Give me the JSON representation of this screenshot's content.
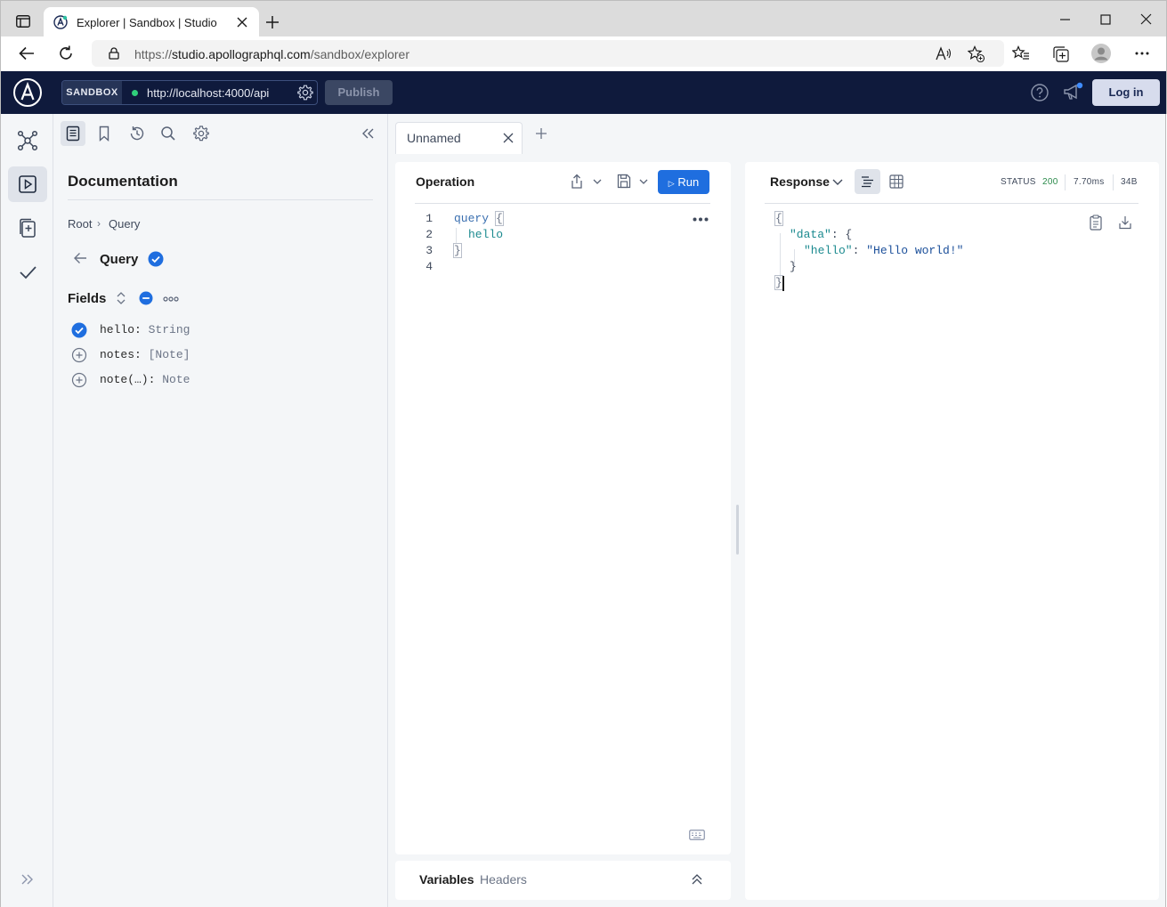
{
  "browser": {
    "tab_title": "Explorer | Sandbox | Studio",
    "url_prefix": "https://",
    "url_domain": "studio.apollographql.com",
    "url_path": "/sandbox/explorer"
  },
  "header": {
    "sandbox_label": "SANDBOX",
    "endpoint": "http://localhost:4000/api",
    "publish_label": "Publish",
    "login_label": "Log in",
    "accent_color": "#0f1a3c"
  },
  "documentation": {
    "title": "Documentation",
    "breadcrumb": [
      "Root",
      "Query"
    ],
    "breadcrumb_sep": "›",
    "type_title": "Query",
    "fields_title": "Fields",
    "fields": [
      {
        "name": "hello:",
        "type": "String",
        "selected": true
      },
      {
        "name": "notes:",
        "type": "[Note]",
        "selected": false
      },
      {
        "name": "note(…):",
        "type": "Note",
        "selected": false
      }
    ]
  },
  "operation": {
    "tab_label": "Unnamed",
    "title": "Operation",
    "run_label": "Run",
    "line_numbers": [
      "1",
      "2",
      "3",
      "4"
    ],
    "code": {
      "keyword": "query",
      "open_brace": "{",
      "field": "hello",
      "close_brace": "}"
    },
    "variables_label": "Variables",
    "headers_label": "Headers"
  },
  "response": {
    "title": "Response",
    "status_label": "STATUS",
    "status_code": "200",
    "time": "7.70ms",
    "size": "34B",
    "json_lines": [
      "{",
      "\"data\": {",
      "\"hello\": \"Hello world!\"",
      "}",
      "}"
    ],
    "data_key": "\"data\"",
    "hello_key": "\"hello\"",
    "hello_value": "\"Hello world!\""
  }
}
